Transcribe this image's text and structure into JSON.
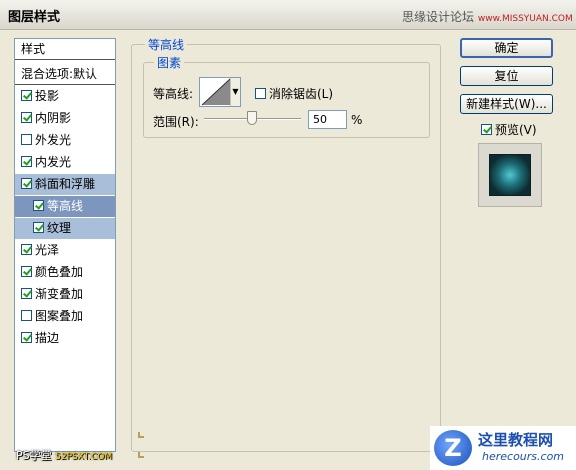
{
  "window": {
    "title": "图层样式",
    "top_watermark_cn": "思缘设计论坛",
    "top_watermark_url": "www.MISSYUAN.COM"
  },
  "style_list": {
    "header": "样式",
    "blend": "混合选项:默认",
    "items": [
      {
        "label": "投影",
        "checked": true
      },
      {
        "label": "内阴影",
        "checked": true
      },
      {
        "label": "外发光",
        "checked": false
      },
      {
        "label": "内发光",
        "checked": true
      },
      {
        "label": "斜面和浮雕",
        "checked": true
      },
      {
        "label": "等高线",
        "checked": true
      },
      {
        "label": "纹理",
        "checked": true
      },
      {
        "label": "光泽",
        "checked": true
      },
      {
        "label": "颜色叠加",
        "checked": true
      },
      {
        "label": "渐变叠加",
        "checked": true
      },
      {
        "label": "图案叠加",
        "checked": false
      },
      {
        "label": "描边",
        "checked": true
      }
    ]
  },
  "contour_panel": {
    "group_title": "等高线",
    "subgroup_title": "图素",
    "contour_label": "等高线:",
    "antialias_label": "消除锯齿(L)",
    "antialias_checked": false,
    "range_label": "范围(R):",
    "range_value": "50",
    "range_unit": "%"
  },
  "buttons": {
    "ok": "确定",
    "reset": "复位",
    "new_style": "新建样式(W)...",
    "preview": "预览(V)",
    "preview_checked": true
  },
  "watermarks": {
    "bottom_left": "PS学堂",
    "bottom_left_site": "52PSXT.COM",
    "bottom_right_name": "这里教程网",
    "bottom_right_url": "herecours.com",
    "bottom_right_logo": "Z"
  }
}
